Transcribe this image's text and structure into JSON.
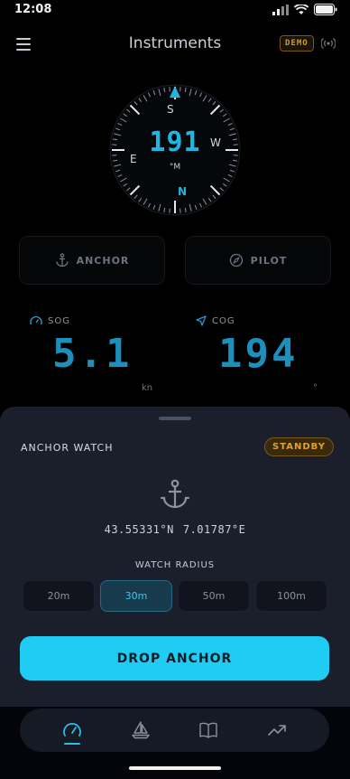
{
  "status_bar": {
    "time": "12:08"
  },
  "header": {
    "title": "Instruments",
    "demo_badge": "DEMO"
  },
  "compass": {
    "heading": "191",
    "heading_unit": "°M",
    "cardinals": {
      "north": "N",
      "east": "E",
      "south": "S",
      "west": "W"
    },
    "accent_color": "#1fb6df"
  },
  "modes": {
    "anchor_label": "ANCHOR",
    "pilot_label": "PILOT"
  },
  "metrics": {
    "sog": {
      "label": "SOG",
      "value": "5.1",
      "unit": "kn"
    },
    "cog": {
      "label": "COG",
      "value": "194",
      "unit": "°"
    }
  },
  "anchor_sheet": {
    "title": "ANCHOR WATCH",
    "status": "STANDBY",
    "latitude": "43.55331°N",
    "longitude": "7.01787°E",
    "radius_title": "WATCH RADIUS",
    "radius_options": [
      "20m",
      "30m",
      "50m",
      "100m"
    ],
    "selected_radius": "30m",
    "action_label": "DROP ANCHOR"
  },
  "tabs": [
    {
      "icon": "gauge-icon",
      "active": true
    },
    {
      "icon": "sailboat-icon",
      "active": false
    },
    {
      "icon": "book-icon",
      "active": false
    },
    {
      "icon": "trend-icon",
      "active": false
    }
  ],
  "colors": {
    "accent": "#1fcdf4",
    "standby": "#e0a12f",
    "sheet_bg": "#1b1f2b"
  }
}
